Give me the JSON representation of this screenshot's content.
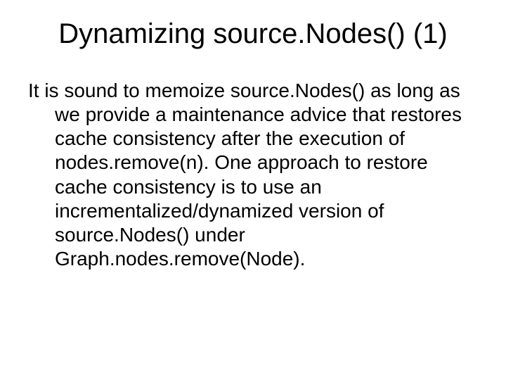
{
  "slide": {
    "title": "Dynamizing source.Nodes() (1)",
    "body": "It is sound to memoize source.Nodes() as long as we provide a maintenance advice that restores cache consistency after the execution of nodes.remove(n). One approach to restore cache consistency is to use an incrementalized/dynamized version of source.Nodes() under Graph.nodes.remove(Node)."
  }
}
